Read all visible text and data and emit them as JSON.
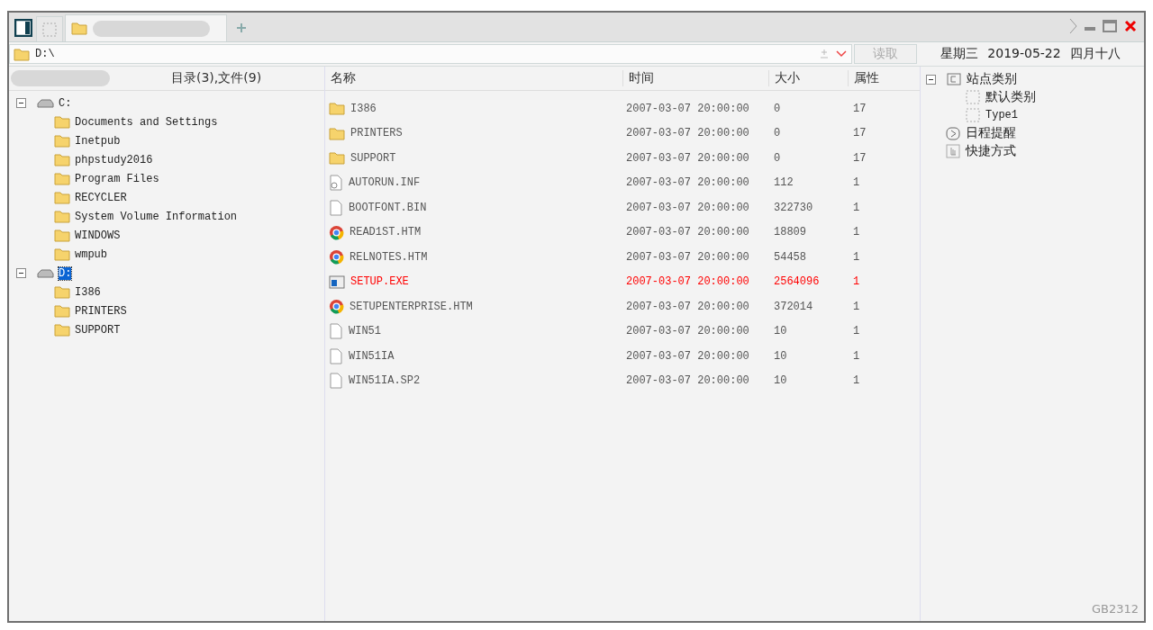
{
  "tabs": [
    {
      "kind": "blank",
      "selected": false
    },
    {
      "kind": "folder",
      "selected": true
    }
  ],
  "address": {
    "value": "D:\\"
  },
  "read_button": {
    "label": "读取",
    "disabled": true
  },
  "date": {
    "weekday": "星期三",
    "date": "2019-05-22",
    "lunar": "四月十八"
  },
  "left_header": "目录(3),文件(9)",
  "tree": [
    {
      "label": "C:",
      "kind": "drive",
      "expanded": true,
      "selected": false,
      "children": [
        {
          "label": "Documents and Settings",
          "kind": "folder"
        },
        {
          "label": "Inetpub",
          "kind": "folder"
        },
        {
          "label": "phpstudy2016",
          "kind": "folder"
        },
        {
          "label": "Program Files",
          "kind": "folder"
        },
        {
          "label": "RECYCLER",
          "kind": "folder"
        },
        {
          "label": "System Volume Information",
          "kind": "folder"
        },
        {
          "label": "WINDOWS",
          "kind": "folder"
        },
        {
          "label": "wmpub",
          "kind": "folder"
        }
      ]
    },
    {
      "label": "D:",
      "kind": "drive",
      "expanded": true,
      "selected": true,
      "children": [
        {
          "label": "I386",
          "kind": "folder"
        },
        {
          "label": "PRINTERS",
          "kind": "folder"
        },
        {
          "label": "SUPPORT",
          "kind": "folder"
        }
      ]
    }
  ],
  "columns": [
    "名称",
    "时间",
    "大小",
    "属性"
  ],
  "rows": [
    {
      "kind": "folder",
      "name": "I386",
      "time": "2007-03-07 20:00:00",
      "size": "0",
      "attr": "17",
      "highlighted": false
    },
    {
      "kind": "folder",
      "name": "PRINTERS",
      "time": "2007-03-07 20:00:00",
      "size": "0",
      "attr": "17",
      "highlighted": false
    },
    {
      "kind": "folder",
      "name": "SUPPORT",
      "time": "2007-03-07 20:00:00",
      "size": "0",
      "attr": "17",
      "highlighted": false
    },
    {
      "kind": "config",
      "name": "AUTORUN.INF",
      "time": "2007-03-07 20:00:00",
      "size": "112",
      "attr": "1",
      "highlighted": false
    },
    {
      "kind": "file",
      "name": "BOOTFONT.BIN",
      "time": "2007-03-07 20:00:00",
      "size": "322730",
      "attr": "1",
      "highlighted": false
    },
    {
      "kind": "web",
      "name": "READ1ST.HTM",
      "time": "2007-03-07 20:00:00",
      "size": "18809",
      "attr": "1",
      "highlighted": false
    },
    {
      "kind": "web",
      "name": "RELNOTES.HTM",
      "time": "2007-03-07 20:00:00",
      "size": "54458",
      "attr": "1",
      "highlighted": false
    },
    {
      "kind": "exe",
      "name": "SETUP.EXE",
      "time": "2007-03-07 20:00:00",
      "size": "2564096",
      "attr": "1",
      "highlighted": true
    },
    {
      "kind": "web",
      "name": "SETUPENTERPRISE.HTM",
      "time": "2007-03-07 20:00:00",
      "size": "372014",
      "attr": "1",
      "highlighted": false
    },
    {
      "kind": "file",
      "name": "WIN51",
      "time": "2007-03-07 20:00:00",
      "size": "10",
      "attr": "1",
      "highlighted": false
    },
    {
      "kind": "file",
      "name": "WIN51IA",
      "time": "2007-03-07 20:00:00",
      "size": "10",
      "attr": "1",
      "highlighted": false
    },
    {
      "kind": "file",
      "name": "WIN51IA.SP2",
      "time": "2007-03-07 20:00:00",
      "size": "10",
      "attr": "1",
      "highlighted": false
    }
  ],
  "side_tree": [
    {
      "label": "站点类别",
      "kind": "category",
      "expanded": true,
      "children": [
        {
          "label": "默认类别",
          "kind": "item"
        },
        {
          "label": "Type1",
          "kind": "item"
        }
      ]
    },
    {
      "label": "日程提醒",
      "kind": "schedule"
    },
    {
      "label": "快捷方式",
      "kind": "shortcut"
    }
  ],
  "status": "GB2312"
}
